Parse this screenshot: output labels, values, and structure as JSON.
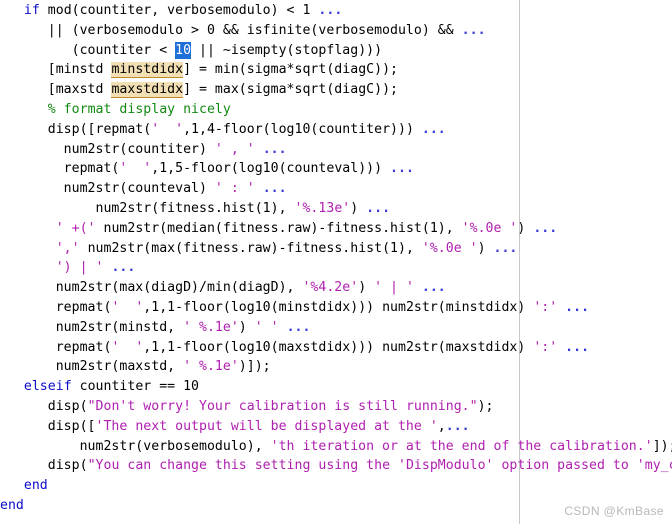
{
  "editor": {
    "language": "MATLAB",
    "margin_ruler_column_x": 519,
    "colors": {
      "background": "#ffffff",
      "text": "#000000",
      "keyword": "#0c0cc8",
      "string": "#b020b0",
      "comment": "#128a12",
      "continuation": "#3a3ad6",
      "selection_background": "#1f6fd8",
      "selection_text": "#ffffff",
      "variable_highlight_background": "#f2dfb3",
      "variable_highlight_underline": "#c08a2e",
      "margin_ruler": "#c8c8c8",
      "watermark": "#b8b8b8"
    },
    "selected_text": "10",
    "highlighted_variables": [
      "minstdidx",
      "maxstdidx"
    ],
    "lines": [
      {
        "n": 1,
        "text": "   if mod(countiter, verbosemodulo) < 1 ...",
        "tokens": [
          {
            "t": "   ",
            "c": "plain"
          },
          {
            "t": "if",
            "c": "kw"
          },
          {
            "t": " mod(countiter, verbosemodulo) < 1 ",
            "c": "plain"
          },
          {
            "t": "...",
            "c": "ell"
          }
        ]
      },
      {
        "n": 2,
        "text": "      || (verbosemodulo > 0 && isfinite(verbosemodulo) && ...",
        "tokens": [
          {
            "t": "      || (verbosemodulo > 0 && isfinite(verbosemodulo) && ",
            "c": "plain"
          },
          {
            "t": "...",
            "c": "ell"
          }
        ]
      },
      {
        "n": 3,
        "text": "         (countiter < 10 || ~isempty(stopflag)))",
        "tokens": [
          {
            "t": "         (countiter < ",
            "c": "plain"
          },
          {
            "t": "10",
            "c": "sel"
          },
          {
            "t": " || ~isempty(stopflag)))",
            "c": "plain"
          }
        ]
      },
      {
        "n": 4,
        "text": "      [minstd minstdidx] = min(sigma*sqrt(diagC));",
        "tokens": [
          {
            "t": "      [minstd ",
            "c": "plain"
          },
          {
            "t": "minstdidx",
            "c": "varhl"
          },
          {
            "t": "] = min(sigma*sqrt(diagC));",
            "c": "plain"
          }
        ]
      },
      {
        "n": 5,
        "text": "      [maxstd maxstdidx] = max(sigma*sqrt(diagC));",
        "tokens": [
          {
            "t": "      [maxstd ",
            "c": "plain"
          },
          {
            "t": "maxstdidx",
            "c": "varhl"
          },
          {
            "t": "] = max(sigma*sqrt(diagC));",
            "c": "plain"
          }
        ]
      },
      {
        "n": 6,
        "text": "      % format display nicely",
        "tokens": [
          {
            "t": "      ",
            "c": "plain"
          },
          {
            "t": "% format display nicely",
            "c": "cmt"
          }
        ]
      },
      {
        "n": 7,
        "text": "      disp([repmat(' ',1,4-floor(log10(countiter))) ...",
        "tokens": [
          {
            "t": "      disp([repmat(",
            "c": "plain"
          },
          {
            "t": "'  '",
            "c": "str"
          },
          {
            "t": ",1,4-floor(log10(countiter))) ",
            "c": "plain"
          },
          {
            "t": "...",
            "c": "ell"
          }
        ]
      },
      {
        "n": 8,
        "text": "        num2str(countiter) ' , ' ...",
        "tokens": [
          {
            "t": "        num2str(countiter) ",
            "c": "plain"
          },
          {
            "t": "' , '",
            "c": "str"
          },
          {
            "t": " ",
            "c": "plain"
          },
          {
            "t": "...",
            "c": "ell"
          }
        ]
      },
      {
        "n": 9,
        "text": "        repmat(' ',1,5-floor(log10(counteval))) ...",
        "tokens": [
          {
            "t": "        repmat(",
            "c": "plain"
          },
          {
            "t": "'  '",
            "c": "str"
          },
          {
            "t": ",1,5-floor(log10(counteval))) ",
            "c": "plain"
          },
          {
            "t": "...",
            "c": "ell"
          }
        ]
      },
      {
        "n": 10,
        "text": "        num2str(counteval) ' : ' ...",
        "tokens": [
          {
            "t": "        num2str(counteval) ",
            "c": "plain"
          },
          {
            "t": "' : '",
            "c": "str"
          },
          {
            "t": " ",
            "c": "plain"
          },
          {
            "t": "...",
            "c": "ell"
          }
        ]
      },
      {
        "n": 11,
        "text": "            num2str(fitness.hist(1), '%.13e') ...",
        "tokens": [
          {
            "t": "            num2str(fitness.hist(1), ",
            "c": "plain"
          },
          {
            "t": "'%.13e'",
            "c": "str"
          },
          {
            "t": ") ",
            "c": "plain"
          },
          {
            "t": "...",
            "c": "ell"
          }
        ]
      },
      {
        "n": 12,
        "text": "        ' +(' num2str(median(fitness.raw)-fitness.hist(1), '%.0e ') ...",
        "tokens": [
          {
            "t": "       ",
            "c": "plain"
          },
          {
            "t": "' +('",
            "c": "str"
          },
          {
            "t": " num2str(median(fitness.raw)-fitness.hist(1), ",
            "c": "plain"
          },
          {
            "t": "'%.0e '",
            "c": "str"
          },
          {
            "t": ") ",
            "c": "plain"
          },
          {
            "t": "...",
            "c": "ell"
          }
        ]
      },
      {
        "n": 13,
        "text": "        ',' num2str(max(fitness.raw)-fitness.hist(1), '%.0e ') ...",
        "tokens": [
          {
            "t": "       ",
            "c": "plain"
          },
          {
            "t": "','",
            "c": "str"
          },
          {
            "t": " num2str(max(fitness.raw)-fitness.hist(1), ",
            "c": "plain"
          },
          {
            "t": "'%.0e '",
            "c": "str"
          },
          {
            "t": ") ",
            "c": "plain"
          },
          {
            "t": "...",
            "c": "ell"
          }
        ]
      },
      {
        "n": 14,
        "text": "        ') | ' ...",
        "tokens": [
          {
            "t": "       ",
            "c": "plain"
          },
          {
            "t": "') | '",
            "c": "str"
          },
          {
            "t": " ",
            "c": "plain"
          },
          {
            "t": "...",
            "c": "ell"
          }
        ]
      },
      {
        "n": 15,
        "text": "        num2str(max(diagD)/min(diagD), '%4.2e') ' | ' ...",
        "tokens": [
          {
            "t": "       num2str(max(diagD)/min(diagD), ",
            "c": "plain"
          },
          {
            "t": "'%4.2e'",
            "c": "str"
          },
          {
            "t": ") ",
            "c": "plain"
          },
          {
            "t": "' | '",
            "c": "str"
          },
          {
            "t": " ",
            "c": "plain"
          },
          {
            "t": "...",
            "c": "ell"
          }
        ]
      },
      {
        "n": 16,
        "text": "        repmat(' ',1,1-floor(log10(minstdidx))) num2str(minstdidx) ':' ...",
        "tokens": [
          {
            "t": "       repmat(",
            "c": "plain"
          },
          {
            "t": "'  '",
            "c": "str"
          },
          {
            "t": ",1,1-floor(log10(minstdidx))) num2str(minstdidx) ",
            "c": "plain"
          },
          {
            "t": "':'",
            "c": "str"
          },
          {
            "t": " ",
            "c": "plain"
          },
          {
            "t": "...",
            "c": "ell"
          }
        ]
      },
      {
        "n": 17,
        "text": "        num2str(minstd, ' %.1e') ' ' ...",
        "tokens": [
          {
            "t": "       num2str(minstd, ",
            "c": "plain"
          },
          {
            "t": "' %.1e'",
            "c": "str"
          },
          {
            "t": ") ",
            "c": "plain"
          },
          {
            "t": "' '",
            "c": "str"
          },
          {
            "t": " ",
            "c": "plain"
          },
          {
            "t": "...",
            "c": "ell"
          }
        ]
      },
      {
        "n": 18,
        "text": "        repmat(' ',1,1-floor(log10(maxstdidx))) num2str(maxstdidx) ':' ...",
        "tokens": [
          {
            "t": "       repmat(",
            "c": "plain"
          },
          {
            "t": "'  '",
            "c": "str"
          },
          {
            "t": ",1,1-floor(log10(maxstdidx))) num2str(maxstdidx) ",
            "c": "plain"
          },
          {
            "t": "':'",
            "c": "str"
          },
          {
            "t": " ",
            "c": "plain"
          },
          {
            "t": "...",
            "c": "ell"
          }
        ]
      },
      {
        "n": 19,
        "text": "        num2str(maxstd, ' %.1e')]);",
        "tokens": [
          {
            "t": "       num2str(maxstd, ",
            "c": "plain"
          },
          {
            "t": "' %.1e'",
            "c": "str"
          },
          {
            "t": ")]);",
            "c": "plain"
          }
        ]
      },
      {
        "n": 20,
        "text": "   elseif countiter == 10",
        "tokens": [
          {
            "t": "   ",
            "c": "plain"
          },
          {
            "t": "elseif",
            "c": "kw"
          },
          {
            "t": " countiter == 10",
            "c": "plain"
          }
        ]
      },
      {
        "n": 21,
        "text": "      disp(\"Don't worry! Your calibration is still running.\");",
        "tokens": [
          {
            "t": "      disp(",
            "c": "plain"
          },
          {
            "t": "\"Don't worry! Your calibration is still running.\"",
            "c": "str"
          },
          {
            "t": ");",
            "c": "plain"
          }
        ]
      },
      {
        "n": 22,
        "text": "      disp(['The next output will be displayed at the ',...",
        "tokens": [
          {
            "t": "      disp([",
            "c": "plain"
          },
          {
            "t": "'The next output will be displayed at the '",
            "c": "str"
          },
          {
            "t": ",",
            "c": "plain"
          },
          {
            "t": "...",
            "c": "ell"
          }
        ]
      },
      {
        "n": 23,
        "text": "          num2str(verbosemodulo), 'th iteration or at the end of the calibration.']);",
        "tokens": [
          {
            "t": "          num2str(verbosemodulo), ",
            "c": "plain"
          },
          {
            "t": "'th iteration or at the end of the calibration.'",
            "c": "str"
          },
          {
            "t": "]);",
            "c": "plain"
          }
        ]
      },
      {
        "n": 24,
        "text": "      disp(\"You can change this setting using the 'DispModulo' option passed to 'my_cmaes'\")",
        "tokens": [
          {
            "t": "      disp(",
            "c": "plain"
          },
          {
            "t": "\"You can change this setting using the 'DispModulo' option passed to 'my_cmaes'\"",
            "c": "str"
          },
          {
            "t": ")",
            "c": "plain"
          }
        ]
      },
      {
        "n": 25,
        "text": "   end",
        "tokens": [
          {
            "t": "   ",
            "c": "plain"
          },
          {
            "t": "end",
            "c": "kw"
          }
        ]
      },
      {
        "n": 26,
        "text": "end",
        "tokens": [
          {
            "t": "end",
            "c": "kw"
          }
        ]
      }
    ]
  },
  "watermark": {
    "text": "CSDN @KmBase"
  }
}
